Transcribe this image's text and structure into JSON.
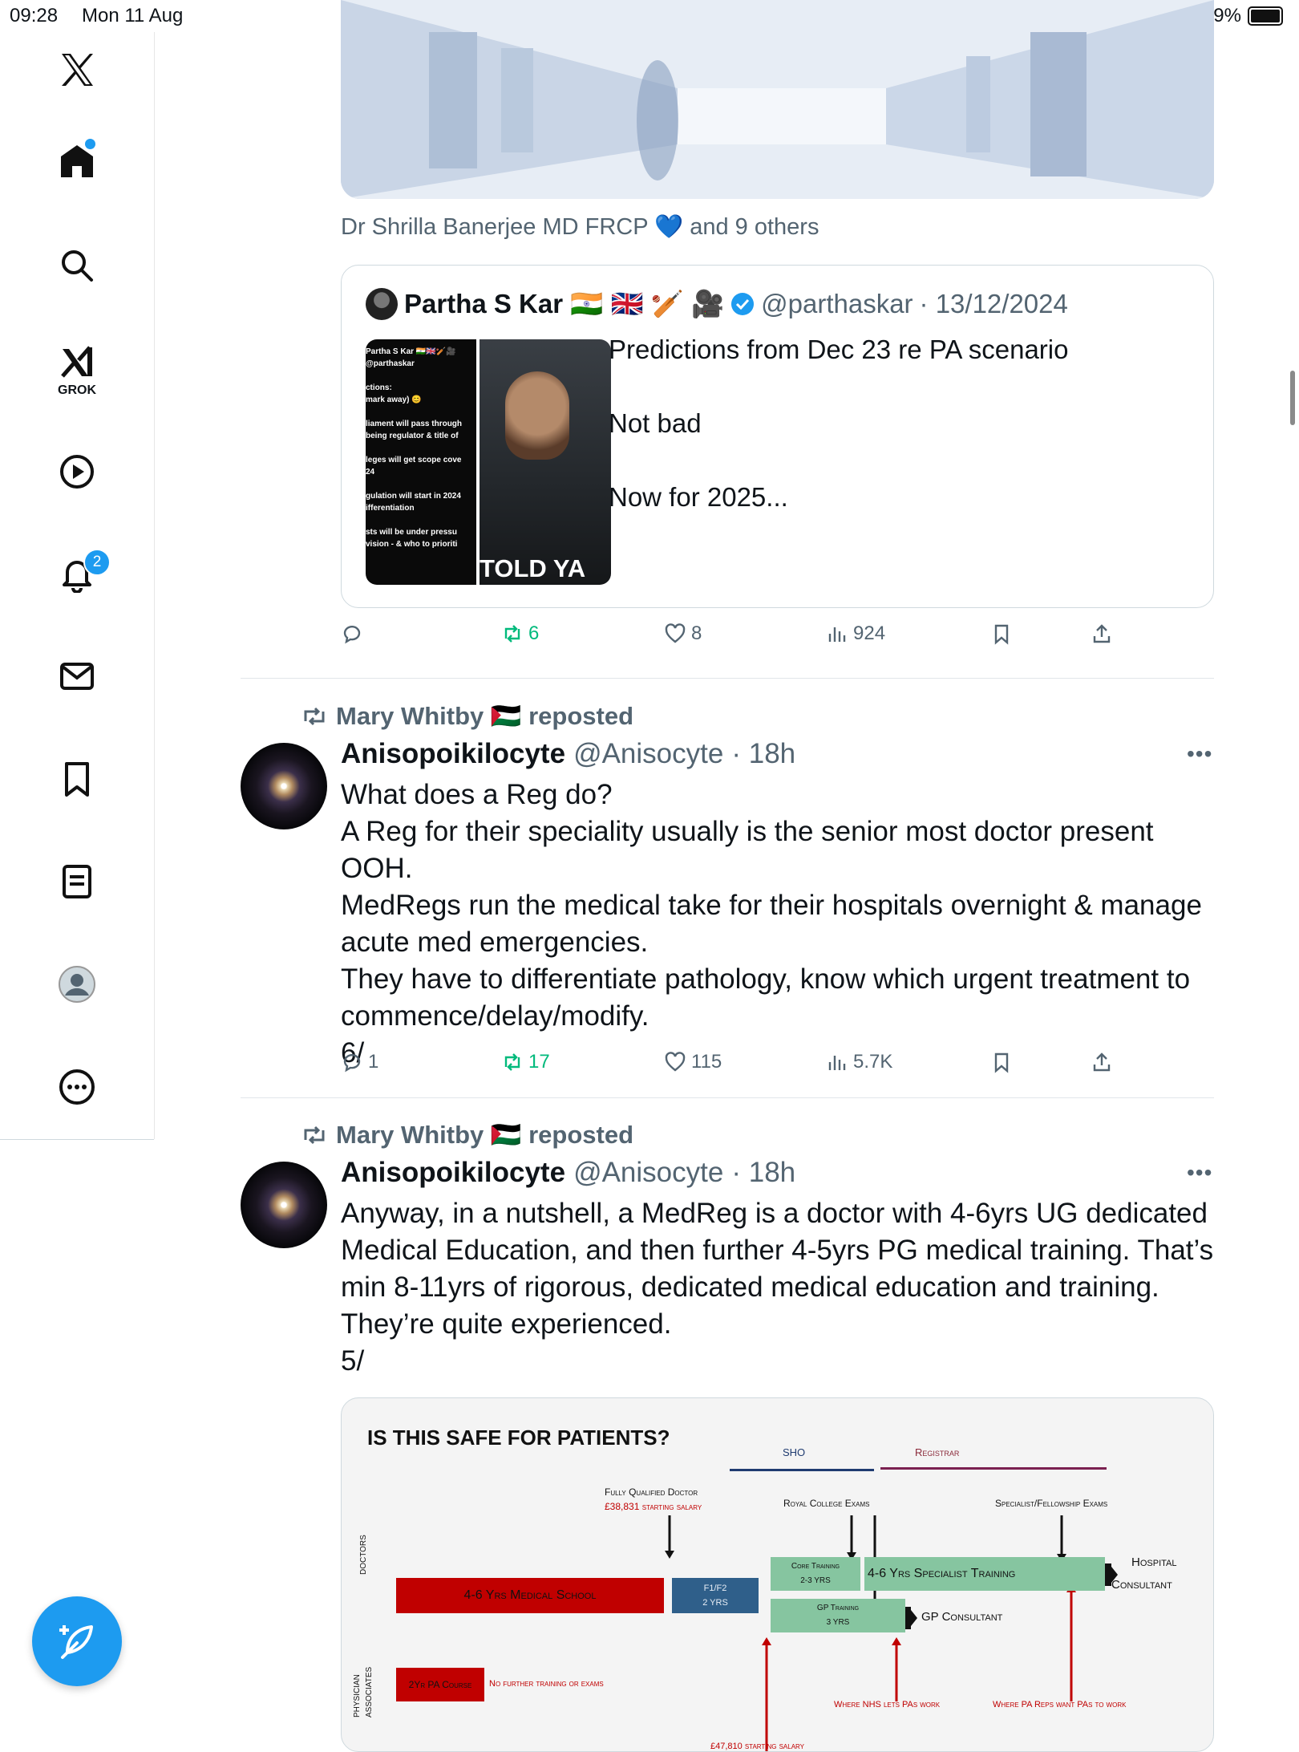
{
  "status_bar": {
    "time": "09:28",
    "date": "Mon 11 Aug",
    "battery": "99%",
    "battery_level": 0.99
  },
  "sidebar": {
    "grok_label": "GROK",
    "notifications_badge": "2"
  },
  "top_tweet": {
    "likers": "Dr Shrilla Banerjee MD FRCP 💙 and 9 others",
    "quote": {
      "name": "Partha S Kar 🇮🇳 🇬🇧 🏏 🎥",
      "handle": "@parthaskar",
      "date": "· 13/12/2024",
      "text_lines": [
        "Predictions from Dec 23 re PA scenario",
        "",
        "Not bad",
        "",
        "Now for 2025..."
      ],
      "media_left_lines": [
        "Partha S Kar 🇮🇳🇬🇧🏏🎥",
        "@parthaskar",
        "",
        "ctions:",
        "mark away) 😊",
        "",
        "liament will pass through",
        "being regulator & title of",
        "",
        "leges will get scope cove",
        "24",
        "",
        "gulation will start in 2024",
        "ifferentiation",
        "",
        "sts will be under pressu",
        "vision - & who to prioriti"
      ],
      "media_right_text": "TOLD YA"
    },
    "actions": {
      "reply": "",
      "reposts": "6",
      "likes": "8",
      "views": "924"
    }
  },
  "posts": [
    {
      "repost_line": "Mary Whitby 🇵🇸 reposted",
      "name": "Anisopoikilocyte",
      "handle": "@Anisocyte",
      "time": "· 18h",
      "lines": [
        "What does a Reg do?",
        "A Reg for their speciality usually is the senior most doctor present OOH.",
        "MedRegs run the medical take for their hospitals overnight & manage",
        "acute med emergencies.",
        "They have to differentiate pathology, know which urgent treatment to",
        "commence/delay/modify.",
        "6/"
      ],
      "actions": {
        "reply": "1",
        "reposts": "17",
        "likes": "115",
        "views": "5.7K"
      }
    },
    {
      "repost_line": "Mary Whitby 🇵🇸 reposted",
      "name": "Anisopoikilocyte",
      "handle": "@Anisocyte",
      "time": "· 18h",
      "lines": [
        "Anyway, in a nutshell, a MedReg is a doctor with 4-6yrs UG dedicated",
        "Medical Education, and then further 4-5yrs PG medical training. That’s",
        "min 8-11yrs of rigorous, dedicated medical education and training.",
        "They’re quite experienced.",
        "5/"
      ]
    }
  ],
  "infographic": {
    "title": "IS THIS SAFE FOR PATIENTS?",
    "sho": "SHO",
    "registrar": "Registrar",
    "fully_qualified": "Fully Qualified Doctor",
    "starting_salary": "£38,831 starting salary",
    "royal_college": "Royal College Exams",
    "specialist_exams": "Specialist/Fellowship Exams",
    "doctors_label": "DOCTORS",
    "pa_label_1": "PHYSICIAN",
    "pa_label_2": "ASSOCIATES",
    "med_school": "4-6 Yrs Medical School",
    "f1f2": "F1/F2",
    "f1f2_yrs": "2 YRS",
    "core_training": "Core Training",
    "core_yrs": "2-3 YRS",
    "specialist_training": "4-6 Yrs Specialist Training",
    "hospital": "Hospital",
    "consultant": "Consultant",
    "gp_training": "GP Training",
    "gp_yrs": "3 YRS",
    "gp_consultant": "GP Consultant",
    "pa_course": "2Yr PA Course",
    "no_further": "No further training or exams",
    "nhs_lets": "Where NHS lets PAs work",
    "pa_reps": "Where PA Reps want PAs to work",
    "pa_salary": "£47,810 starting salary",
    "colors": {
      "red": "#c00000",
      "blue": "#2f5f8a",
      "green": "#86c5a0"
    }
  }
}
